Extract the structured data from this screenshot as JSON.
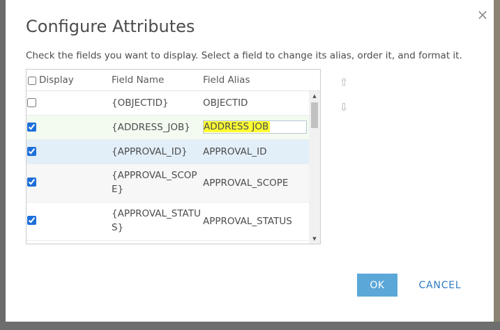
{
  "dialog": {
    "title": "Configure Attributes",
    "instructions": "Check the fields you want to display. Select a field to change its alias, order it, and format it.",
    "close_icon": "×"
  },
  "grid": {
    "columns": {
      "display": "Display",
      "field_name": "Field Name",
      "field_alias": "Field Alias"
    },
    "select_all_checked": false,
    "rows": [
      {
        "checked": false,
        "field_name": "{OBJECTID}",
        "field_alias": "OBJECTID"
      },
      {
        "checked": true,
        "field_name": "{ADDRESS_JOB}",
        "field_alias": "ADDRESS JOB",
        "editing": true
      },
      {
        "checked": true,
        "field_name": "{APPROVAL_ID}",
        "field_alias": "APPROVAL_ID",
        "selected": true
      },
      {
        "checked": true,
        "field_name": "{APPROVAL_SCOPE}",
        "field_alias": "APPROVAL_SCOPE"
      },
      {
        "checked": true,
        "field_name": "{APPROVAL_STATUS}",
        "field_alias": "APPROVAL_STATUS"
      }
    ]
  },
  "icons": {
    "move_up": "arrow-up-icon",
    "move_down": "arrow-down-icon",
    "scroll_up": "scroll-up-icon",
    "scroll_down": "scroll-down-icon"
  },
  "colors": {
    "ok_button": "#5ba7d8",
    "cancel_text": "#2e7bc2",
    "selected_row": "#e2eef8",
    "alias_highlight": "#ffff33"
  },
  "buttons": {
    "ok": "OK",
    "cancel": "CANCEL"
  }
}
